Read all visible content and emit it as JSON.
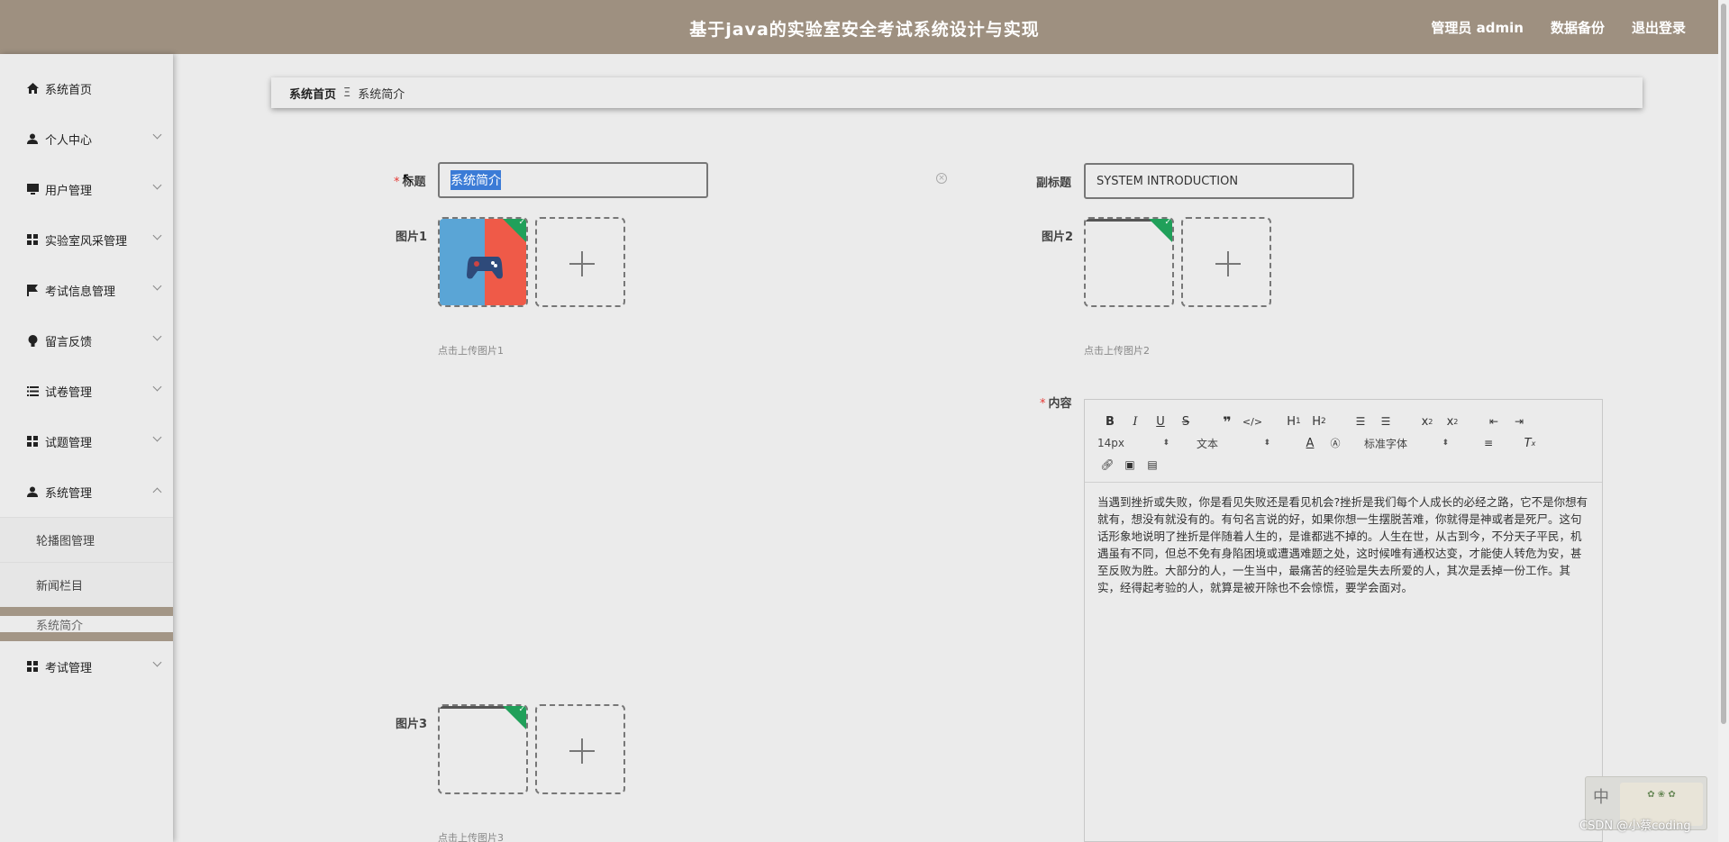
{
  "header": {
    "title": "基于java的实验室安全考试系统设计与实现",
    "admin_label": "管理员 admin",
    "backup_label": "数据备份",
    "logout_label": "退出登录"
  },
  "sidebar": {
    "items": [
      {
        "label": "系统首页",
        "icon": "home-icon"
      },
      {
        "label": "个人中心",
        "icon": "user-icon"
      },
      {
        "label": "用户管理",
        "icon": "monitor-icon"
      },
      {
        "label": "实验室风采管理",
        "icon": "grid-icon"
      },
      {
        "label": "考试信息管理",
        "icon": "flag-icon"
      },
      {
        "label": "留言反馈",
        "icon": "bulb-icon"
      },
      {
        "label": "试卷管理",
        "icon": "list-icon"
      },
      {
        "label": "试题管理",
        "icon": "grid-icon"
      },
      {
        "label": "系统管理",
        "icon": "user-icon"
      },
      {
        "label": "考试管理",
        "icon": "grid-icon"
      }
    ],
    "sub_items": [
      "轮播图管理",
      "新闻栏目",
      "系统简介"
    ]
  },
  "breadcrumb": {
    "home": "系统首页",
    "separator": "Ξ",
    "current": "系统简介"
  },
  "form": {
    "title_label": "标题",
    "title_value": "系统简介",
    "subtitle_label": "副标题",
    "subtitle_value": "SYSTEM INTRODUCTION",
    "image1_label": "图片1",
    "image1_hint": "点击上传图片1",
    "image2_label": "图片2",
    "image2_hint": "点击上传图片2",
    "image3_label": "图片3",
    "image3_hint": "点击上传图片3",
    "content_label": "内容"
  },
  "editor": {
    "font_size": "14px",
    "block_type": "文本",
    "font_family": "标准字体",
    "content": "当遇到挫折或失败，你是看见失败还是看见机会?挫折是我们每个人成长的必经之路，它不是你想有就有，想没有就没有的。有句名言说的好，如果你想一生摆脱苦难，你就得是神或者是死尸。这句话形象地说明了挫折是伴随着人生的，是谁都逃不掉的。人生在世，从古到今，不分天子平民，机遇虽有不同，但总不免有身陷困境或遭遇难题之处，这时候唯有通权达变，才能使人转危为安，甚至反败为胜。大部分的人，一生当中，最痛苦的经验是失去所爱的人，其次是丢掉一份工作。其实，经得起考验的人，就算是被开除也不会惊慌，要学会面对。"
  },
  "overlay": {
    "ime_char": "中",
    "watermark": "CSDN @小蔡coding"
  }
}
